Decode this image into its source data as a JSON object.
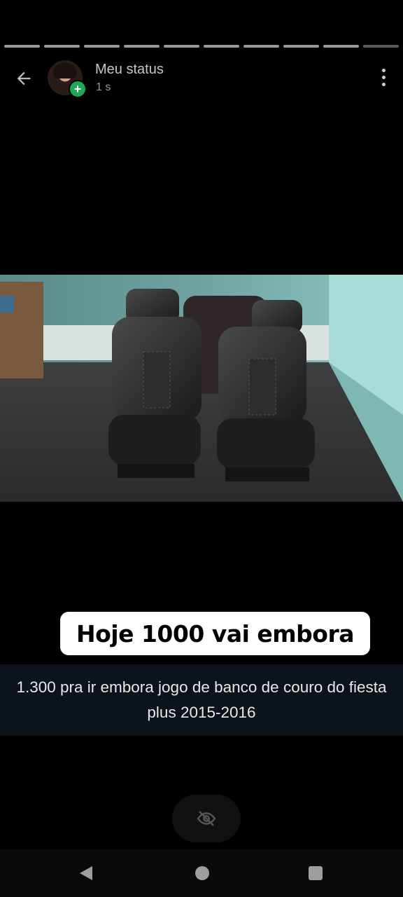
{
  "status": {
    "segments": 10,
    "header": {
      "title": "Meu status",
      "time": "1 s"
    },
    "sticker_text": "Hoje 1000 vai embora",
    "caption": "1.300 pra ir embora jogo de banco de couro do fiesta plus 2015-2016"
  },
  "icons": {
    "back": "arrow-left-icon",
    "add": "plus-icon",
    "menu": "more-vertical-icon",
    "viewers": "eye-off-icon",
    "nav_back": "triangle-back-icon",
    "nav_home": "circle-home-icon",
    "nav_recent": "square-recent-icon"
  },
  "colors": {
    "add_badge": "#1fa855",
    "caption_bg": "#0c131a"
  }
}
